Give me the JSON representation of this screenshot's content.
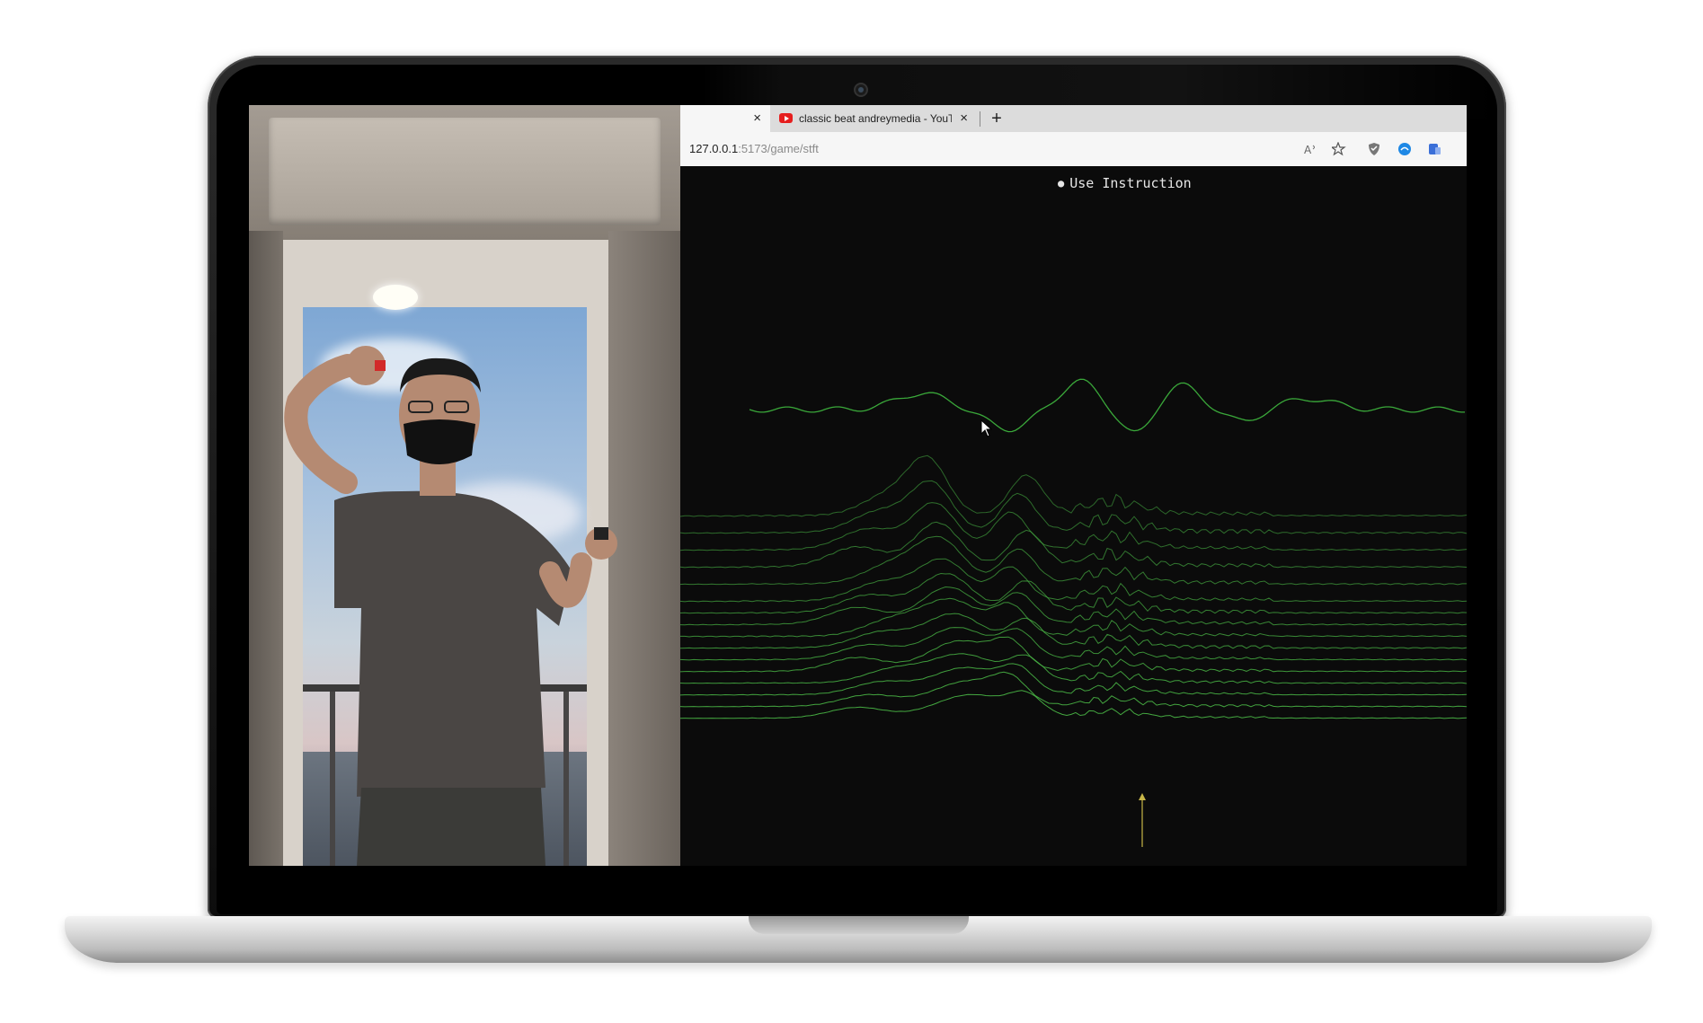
{
  "browser": {
    "tabs": [
      {
        "label": "",
        "active": true
      },
      {
        "label": "classic beat andreymedia - YouTube",
        "favicon": "youtube-icon",
        "active": false
      }
    ],
    "new_tab_symbol": "+",
    "close_symbol": "×",
    "url_host": "127.0.0.1",
    "url_rest": ":5173/game/stft",
    "toolbar_icons": [
      "read-aloud-icon",
      "favorites-icon",
      "shield-icon",
      "browser-essentials-icon",
      "extension-icon"
    ]
  },
  "page": {
    "instruction_label": "Use Instruction"
  },
  "colors": {
    "waveform": "#3aa83a",
    "spectrogram": "#49b545",
    "marker": "#c8b648",
    "background": "#0b0b0b"
  }
}
